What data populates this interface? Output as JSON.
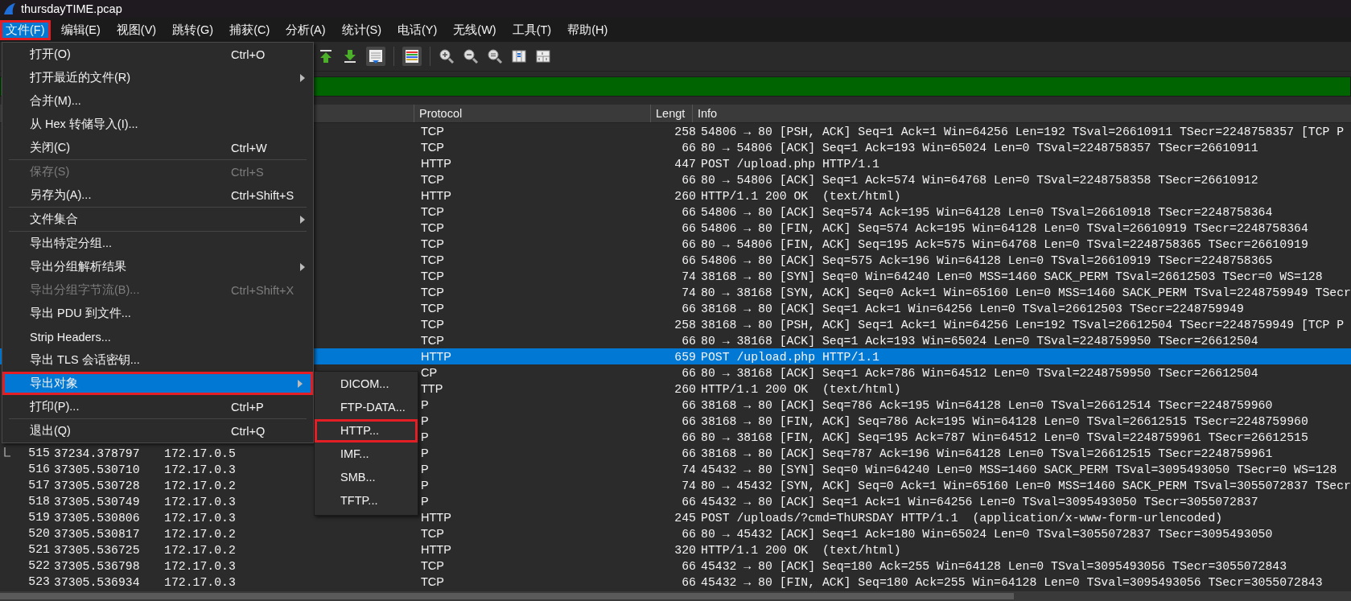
{
  "window": {
    "title": "thursdayTIME.pcap"
  },
  "menubar": [
    {
      "label": "文件(F)",
      "selected": true,
      "annotated": true
    },
    {
      "label": "编辑(E)",
      "selected": false,
      "annotated": false
    },
    {
      "label": "视图(V)",
      "selected": false,
      "annotated": false
    },
    {
      "label": "跳转(G)",
      "selected": false,
      "annotated": false
    },
    {
      "label": "捕获(C)",
      "selected": false,
      "annotated": false
    },
    {
      "label": "分析(A)",
      "selected": false,
      "annotated": false
    },
    {
      "label": "统计(S)",
      "selected": false,
      "annotated": false
    },
    {
      "label": "电话(Y)",
      "selected": false,
      "annotated": false
    },
    {
      "label": "无线(W)",
      "selected": false,
      "annotated": false
    },
    {
      "label": "工具(T)",
      "selected": false,
      "annotated": false
    },
    {
      "label": "帮助(H)",
      "selected": false,
      "annotated": false
    }
  ],
  "file_menu": [
    {
      "kind": "item",
      "label": "打开(O)",
      "shortcut": "Ctrl+O",
      "submenu": false,
      "disabled": false,
      "selected": false,
      "annotated": false
    },
    {
      "kind": "item",
      "label": "打开最近的文件(R)",
      "submenu": true,
      "disabled": false,
      "selected": false,
      "annotated": false
    },
    {
      "kind": "item",
      "label": "合并(M)...",
      "submenu": false,
      "disabled": false,
      "selected": false,
      "annotated": false
    },
    {
      "kind": "item",
      "label": "从 Hex 转储导入(I)...",
      "submenu": false,
      "disabled": false,
      "selected": false,
      "annotated": false
    },
    {
      "kind": "item",
      "label": "关闭(C)",
      "shortcut": "Ctrl+W",
      "submenu": false,
      "disabled": false,
      "selected": false,
      "annotated": false
    },
    {
      "kind": "separator"
    },
    {
      "kind": "item",
      "label": "保存(S)",
      "shortcut": "Ctrl+S",
      "submenu": false,
      "disabled": true,
      "selected": false,
      "annotated": false
    },
    {
      "kind": "item",
      "label": "另存为(A)...",
      "shortcut": "Ctrl+Shift+S",
      "submenu": false,
      "disabled": false,
      "selected": false,
      "annotated": false
    },
    {
      "kind": "separator"
    },
    {
      "kind": "item",
      "label": "文件集合",
      "submenu": true,
      "disabled": false,
      "selected": false,
      "annotated": false
    },
    {
      "kind": "separator"
    },
    {
      "kind": "item",
      "label": "导出特定分组...",
      "submenu": false,
      "disabled": false,
      "selected": false,
      "annotated": false
    },
    {
      "kind": "item",
      "label": "导出分组解析结果",
      "submenu": true,
      "disabled": false,
      "selected": false,
      "annotated": false
    },
    {
      "kind": "item",
      "label": "导出分组字节流(B)...",
      "shortcut": "Ctrl+Shift+X",
      "submenu": false,
      "disabled": true,
      "selected": false,
      "annotated": false
    },
    {
      "kind": "item",
      "label": "导出 PDU 到文件...",
      "submenu": false,
      "disabled": false,
      "selected": false,
      "annotated": false
    },
    {
      "kind": "item",
      "label": "Strip Headers...",
      "submenu": false,
      "disabled": false,
      "selected": false,
      "annotated": false
    },
    {
      "kind": "item",
      "label": "导出 TLS 会话密钥...",
      "submenu": false,
      "disabled": false,
      "selected": false,
      "annotated": false
    },
    {
      "kind": "item",
      "label": "导出对象",
      "submenu": true,
      "disabled": false,
      "selected": true,
      "annotated": true
    },
    {
      "kind": "item",
      "label": "打印(P)...",
      "shortcut": "Ctrl+P",
      "submenu": false,
      "disabled": false,
      "selected": false,
      "annotated": false
    },
    {
      "kind": "separator"
    },
    {
      "kind": "item",
      "label": "退出(Q)",
      "shortcut": "Ctrl+Q",
      "submenu": false,
      "disabled": false,
      "selected": false,
      "annotated": false
    }
  ],
  "export_objects_menu": [
    {
      "label": "DICOM...",
      "selected": false,
      "annotated": false
    },
    {
      "label": "FTP-DATA...",
      "selected": false,
      "annotated": false
    },
    {
      "label": "HTTP...",
      "selected": false,
      "annotated": true
    },
    {
      "label": "IMF...",
      "selected": false,
      "annotated": false
    },
    {
      "label": "SMB...",
      "selected": false,
      "annotated": false
    },
    {
      "label": "TFTP...",
      "selected": false,
      "annotated": false
    }
  ],
  "packet_list": {
    "columns": [
      {
        "label": "Protocol"
      },
      {
        "label": "Lengt"
      },
      {
        "label": "Info"
      }
    ],
    "rows": [
      {
        "protocol": "TCP",
        "length": "258",
        "info": "54806 → 80 [PSH, ACK] Seq=1 Ack=1 Win=64256 Len=192 TSval=26610911 TSecr=2248758357 [TCP P",
        "selected": false,
        "related": false
      },
      {
        "protocol": "TCP",
        "length": "66",
        "info": "80 → 54806 [ACK] Seq=1 Ack=193 Win=65024 Len=0 TSval=2248758357 TSecr=26610911",
        "selected": false,
        "related": false
      },
      {
        "protocol": "HTTP",
        "length": "447",
        "info": "POST /upload.php HTTP/1.1",
        "selected": false,
        "related": false
      },
      {
        "protocol": "TCP",
        "length": "66",
        "info": "80 → 54806 [ACK] Seq=1 Ack=574 Win=64768 Len=0 TSval=2248758358 TSecr=26610912",
        "selected": false,
        "related": false
      },
      {
        "protocol": "HTTP",
        "length": "260",
        "info": "HTTP/1.1 200 OK  (text/html)",
        "selected": false,
        "related": false
      },
      {
        "protocol": "TCP",
        "length": "66",
        "info": "54806 → 80 [ACK] Seq=574 Ack=195 Win=64128 Len=0 TSval=26610918 TSecr=2248758364",
        "selected": false,
        "related": false
      },
      {
        "protocol": "TCP",
        "length": "66",
        "info": "54806 → 80 [FIN, ACK] Seq=574 Ack=195 Win=64128 Len=0 TSval=26610919 TSecr=2248758364",
        "selected": false,
        "related": false
      },
      {
        "protocol": "TCP",
        "length": "66",
        "info": "80 → 54806 [FIN, ACK] Seq=195 Ack=575 Win=64768 Len=0 TSval=2248758365 TSecr=26610919",
        "selected": false,
        "related": false
      },
      {
        "protocol": "TCP",
        "length": "66",
        "info": "54806 → 80 [ACK] Seq=575 Ack=196 Win=64128 Len=0 TSval=26610919 TSecr=2248758365",
        "selected": false,
        "related": false
      },
      {
        "protocol": "TCP",
        "length": "74",
        "info": "38168 → 80 [SYN] Seq=0 Win=64240 Len=0 MSS=1460 SACK_PERM TSval=26612503 TSecr=0 WS=128",
        "selected": false,
        "related": false
      },
      {
        "protocol": "TCP",
        "length": "74",
        "info": "80 → 38168 [SYN, ACK] Seq=0 Ack=1 Win=65160 Len=0 MSS=1460 SACK_PERM TSval=2248759949 TSecr",
        "selected": false,
        "related": false
      },
      {
        "protocol": "TCP",
        "length": "66",
        "info": "38168 → 80 [ACK] Seq=1 Ack=1 Win=64256 Len=0 TSval=26612503 TSecr=2248759949",
        "selected": false,
        "related": false
      },
      {
        "protocol": "TCP",
        "length": "258",
        "info": "38168 → 80 [PSH, ACK] Seq=1 Ack=1 Win=64256 Len=192 TSval=26612504 TSecr=2248759949 [TCP P",
        "selected": false,
        "related": false
      },
      {
        "protocol": "TCP",
        "length": "66",
        "info": "80 → 38168 [ACK] Seq=1 Ack=193 Win=65024 Len=0 TSval=2248759950 TSecr=26612504",
        "selected": false,
        "related": false
      },
      {
        "protocol": "HTTP",
        "length": "659",
        "info": "POST /upload.php HTTP/1.1",
        "selected": true,
        "related": false
      },
      {
        "protocol": "CP",
        "length": "66",
        "info": "80 → 38168 [ACK] Seq=1 Ack=786 Win=64512 Len=0 TSval=2248759950 TSecr=26612504",
        "selected": false,
        "related": false
      },
      {
        "protocol": "TTP",
        "length": "260",
        "info": "HTTP/1.1 200 OK  (text/html)",
        "selected": false,
        "related": false
      },
      {
        "protocol": "P",
        "length": "66",
        "info": "38168 → 80 [ACK] Seq=786 Ack=195 Win=64128 Len=0 TSval=26612514 TSecr=2248759960",
        "selected": false,
        "related": false
      },
      {
        "protocol": "P",
        "length": "66",
        "info": "38168 → 80 [FIN, ACK] Seq=786 Ack=195 Win=64128 Len=0 TSval=26612515 TSecr=2248759960",
        "selected": false,
        "related": false
      },
      {
        "protocol": "P",
        "length": "66",
        "info": "80 → 38168 [FIN, ACK] Seq=195 Ack=787 Win=64512 Len=0 TSval=2248759961 TSecr=26612515",
        "selected": false,
        "related": false
      },
      {
        "no": "515",
        "time": "37234.378797",
        "source": "172.17.0.5",
        "protocol": "P",
        "length": "66",
        "info": "38168 → 80 [ACK] Seq=787 Ack=196 Win=64128 Len=0 TSval=26612515 TSecr=2248759961",
        "selected": false,
        "related": true
      },
      {
        "no": "516",
        "time": "37305.530710",
        "source": "172.17.0.3",
        "protocol": "P",
        "length": "74",
        "info": "45432 → 80 [SYN] Seq=0 Win=64240 Len=0 MSS=1460 SACK_PERM TSval=3095493050 TSecr=0 WS=128",
        "selected": false,
        "related": false
      },
      {
        "no": "517",
        "time": "37305.530728",
        "source": "172.17.0.2",
        "protocol": "P",
        "length": "74",
        "info": "80 → 45432 [SYN, ACK] Seq=0 Ack=1 Win=65160 Len=0 MSS=1460 SACK_PERM TSval=3055072837 TSecr",
        "selected": false,
        "related": false
      },
      {
        "no": "518",
        "time": "37305.530749",
        "source": "172.17.0.3",
        "protocol": "P",
        "length": "66",
        "info": "45432 → 80 [ACK] Seq=1 Ack=1 Win=64256 Len=0 TSval=3095493050 TSecr=3055072837",
        "selected": false,
        "related": false
      },
      {
        "no": "519",
        "time": "37305.530806",
        "source": "172.17.0.3",
        "protocol": "HTTP",
        "length": "245",
        "info": "POST /uploads/?cmd=ThURSDAY HTTP/1.1  (application/x-www-form-urlencoded)",
        "selected": false,
        "related": false
      },
      {
        "no": "520",
        "time": "37305.530817",
        "source": "172.17.0.2",
        "protocol": "TCP",
        "length": "66",
        "info": "80 → 45432 [ACK] Seq=1 Ack=180 Win=65024 Len=0 TSval=3055072837 TSecr=3095493050",
        "selected": false,
        "related": false
      },
      {
        "no": "521",
        "time": "37305.536725",
        "source": "172.17.0.2",
        "protocol": "HTTP",
        "length": "320",
        "info": "HTTP/1.1 200 OK  (text/html)",
        "selected": false,
        "related": false
      },
      {
        "no": "522",
        "time": "37305.536798",
        "source": "172.17.0.3",
        "protocol": "TCP",
        "length": "66",
        "info": "45432 → 80 [ACK] Seq=180 Ack=255 Win=64128 Len=0 TSval=3095493056 TSecr=3055072843",
        "selected": false,
        "related": false
      },
      {
        "no": "523",
        "time": "37305.536934",
        "source": "172.17.0.3",
        "protocol": "TCP",
        "length": "66",
        "info": "45432 → 80 [FIN, ACK] Seq=180 Ack=255 Win=64128 Len=0 TSval=3095493056 TSecr=3055072843",
        "selected": false,
        "related": false
      }
    ]
  }
}
